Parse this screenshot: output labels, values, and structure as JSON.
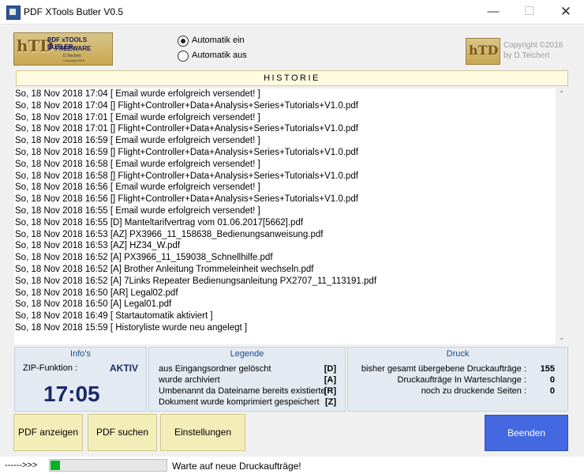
{
  "window": {
    "title": "PDF XTools Butler V0.5"
  },
  "logo": {
    "text": "hTD",
    "title": "PDF xTOOLS BUTLER",
    "subtitle": "FREEWARE",
    "author": "D.Teichert",
    "copyright": "Copyright 2018"
  },
  "radio": [
    {
      "label": "Automatik ein",
      "selected": true
    },
    {
      "label": "Automatik aus",
      "selected": false
    }
  ],
  "copyright": {
    "line1": "Copyright ©2018",
    "line2": "by D.Teichert"
  },
  "historie": {
    "title": "HISTORIE",
    "lines": [
      "So, 18 Nov 2018 17:04  [ Email wurde erfolgreich versendet! ]",
      "So, 18 Nov 2018 17:04  []  Flight+Controller+Data+Analysis+Series+Tutorials+V1.0.pdf",
      "So, 18 Nov 2018 17:01  [ Email wurde erfolgreich versendet! ]",
      "So, 18 Nov 2018 17:01  []  Flight+Controller+Data+Analysis+Series+Tutorials+V1.0.pdf",
      "So, 18 Nov 2018 16:59  [ Email wurde erfolgreich versendet! ]",
      "So, 18 Nov 2018 16:59  []  Flight+Controller+Data+Analysis+Series+Tutorials+V1.0.pdf",
      "So, 18 Nov 2018 16:58  [ Email wurde erfolgreich versendet! ]",
      "So, 18 Nov 2018 16:58  []  Flight+Controller+Data+Analysis+Series+Tutorials+V1.0.pdf",
      "So, 18 Nov 2018 16:56  [ Email wurde erfolgreich versendet! ]",
      "So, 18 Nov 2018 16:56  []  Flight+Controller+Data+Analysis+Series+Tutorials+V1.0.pdf",
      "So, 18 Nov 2018 16:55  [ Email wurde erfolgreich versendet! ]",
      "So, 18 Nov 2018 16:55  [D]  Manteltarifvertrag vom 01.06.2017[5662].pdf",
      "So, 18 Nov 2018 16:53  [AZ]  PX3966_11_158638_Bedienungsanweisung.pdf",
      "So, 18 Nov 2018 16:53  [AZ]  HZ34_W.pdf",
      "So, 18 Nov 2018 16:52  [A]  PX3966_11_159038_Schnellhilfe.pdf",
      "So, 18 Nov 2018 16:52  [A]  Brother Anleitung Trommeleinheit wechseln.pdf",
      "So, 18 Nov 2018 16:52  [A]  7Links Repeater Bedienungsanleitung PX2707_11_113191.pdf",
      "So, 18 Nov 2018 16:50  [AR]  Legal02.pdf",
      "So, 18 Nov 2018 16:50  [A]  Legal01.pdf",
      "So, 18 Nov 2018 16:49  [ Startautomatik aktiviert ]",
      "So, 18 Nov 2018 15:59  [ Historyliste wurde neu angelegt ]"
    ]
  },
  "info": {
    "title": "Info's",
    "zip_label": "ZIP-Funktion :",
    "zip_value": "AKTIV",
    "time": "17:05"
  },
  "legende": {
    "title": "Legende",
    "items": [
      {
        "text": "aus Eingangsordner gelöscht",
        "code": "[D]"
      },
      {
        "text": "wurde archiviert",
        "code": "[A]"
      },
      {
        "text": "Umbenannt da Dateiname bereits existierte",
        "code": "[R]"
      },
      {
        "text": "Dokument wurde komprimiert gespeichert",
        "code": "[Z]"
      }
    ]
  },
  "druck": {
    "title": "Druck",
    "items": [
      {
        "label": "bisher gesamt übergebene Druckaufträge :",
        "value": "155"
      },
      {
        "label": "Druckaufträge In Warteschlange :",
        "value": "0"
      },
      {
        "label": "noch zu druckende Seiten :",
        "value": "0"
      }
    ]
  },
  "buttons": {
    "pdf_anzeigen": "PDF anzeigen",
    "pdf_suchen": "PDF suchen",
    "einstellungen": "Einstellungen",
    "beenden": "Beenden"
  },
  "status": {
    "arrow": "------>>>",
    "progress_percent": 8,
    "progress_color": "#06b025",
    "text": "Warte auf neue Druckaufträge!"
  },
  "colors": {
    "accent": "#4468e0",
    "button_bg": "#f3eeb8",
    "panel_bg": "#e4eaf2",
    "header_bg": "#fffbe0"
  }
}
